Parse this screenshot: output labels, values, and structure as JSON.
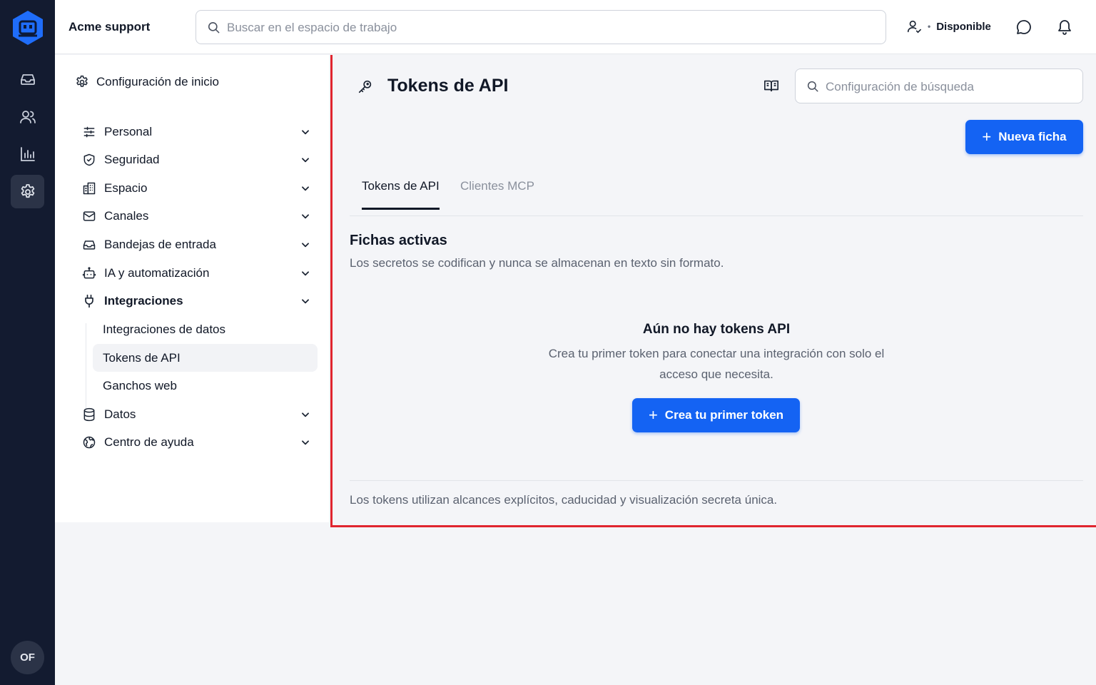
{
  "workspace": {
    "name": "Acme support"
  },
  "search": {
    "placeholder": "Buscar en el espacio de trabajo"
  },
  "status": {
    "label": "Disponible"
  },
  "user": {
    "initials": "OF"
  },
  "colors": {
    "accent": "#1463f3",
    "rail": "#131b30",
    "highlight": "#e0252f"
  },
  "rail": {
    "items": [
      {
        "icon": "inbox-icon"
      },
      {
        "icon": "users-icon"
      },
      {
        "icon": "bar-chart-icon"
      },
      {
        "icon": "gear-icon",
        "active": true
      }
    ]
  },
  "sidebar": {
    "header": "Configuración de inicio",
    "items": [
      {
        "label": "Personal",
        "icon": "sliders-icon"
      },
      {
        "label": "Seguridad",
        "icon": "shield-icon"
      },
      {
        "label": "Espacio",
        "icon": "building-icon"
      },
      {
        "label": "Canales",
        "icon": "mail-icon"
      },
      {
        "label": "Bandejas de entrada",
        "icon": "inbox-icon"
      },
      {
        "label": "IA y automatización",
        "icon": "bot-icon"
      },
      {
        "label": "Integraciones",
        "icon": "plug-icon",
        "expanded": true
      },
      {
        "label": "Datos",
        "icon": "database-icon"
      },
      {
        "label": "Centro de ayuda",
        "icon": "globe-icon"
      }
    ],
    "subitems": [
      {
        "label": "Integraciones de datos"
      },
      {
        "label": "Tokens de API",
        "active": true
      },
      {
        "label": "Ganchos web"
      }
    ]
  },
  "main": {
    "title": "Tokens de API",
    "search_placeholder": "Configuración de búsqueda",
    "new_button": "Nueva ficha",
    "tabs": [
      {
        "label": "Tokens de API",
        "active": true
      },
      {
        "label": "Clientes MCP"
      }
    ],
    "section_title": "Fichas activas",
    "section_desc": "Los secretos se codifican y nunca se almacenan en texto sin formato.",
    "empty_title": "Aún no hay tokens API",
    "empty_desc": "Crea tu primer token para conectar una integración con solo el acceso que necesita.",
    "create_button": "Crea tu primer token",
    "footer_note": "Los tokens utilizan alcances explícitos, caducidad y visualización secreta única."
  }
}
